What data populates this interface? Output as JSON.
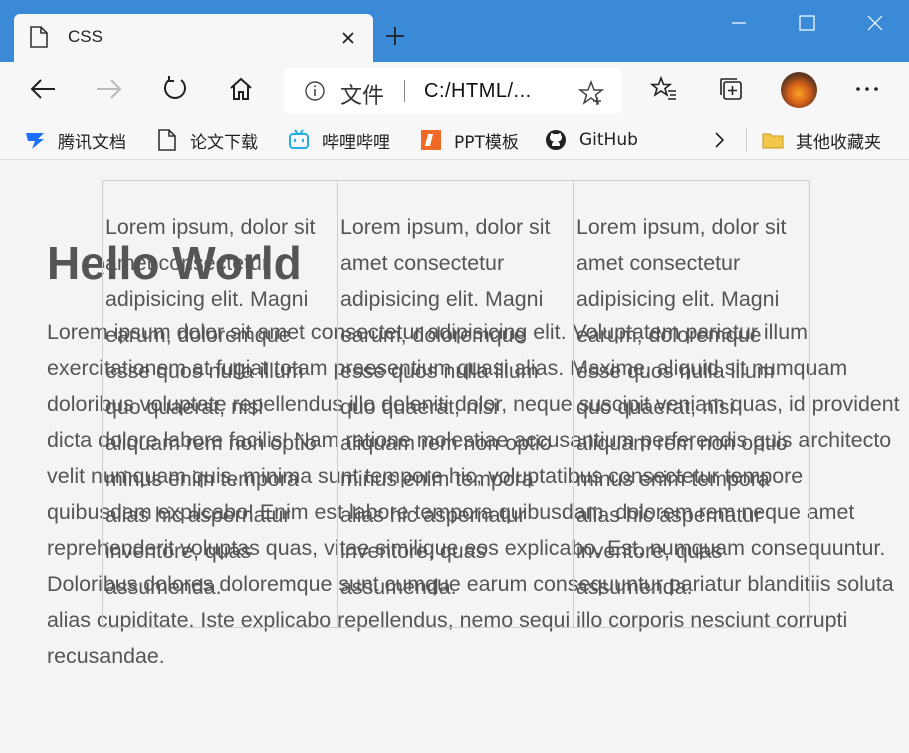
{
  "browser": {
    "tab": {
      "title": "CSS"
    },
    "address": {
      "scheme_label": "文件",
      "url": "C:/HTML/..."
    },
    "bookmarks": [
      {
        "label": "腾讯文档",
        "icon": "tencent-docs-icon"
      },
      {
        "label": "论文下载",
        "icon": "document-icon"
      },
      {
        "label": "哔哩哔哩",
        "icon": "bilibili-icon"
      },
      {
        "label": "PPT模板",
        "icon": "ppt-icon"
      },
      {
        "label": "GitHub",
        "icon": "github-icon"
      }
    ],
    "other_bookmarks": {
      "label": "其他收藏夹",
      "icon": "folder-icon"
    },
    "colors": {
      "titlebar": "#3b8ad8",
      "toolbar": "#f7f7f7",
      "page_bg": "#f4f4f4",
      "text": "#555555"
    }
  },
  "page": {
    "heading": "Hello World",
    "paragraph": "Lorem ipsum dolor sit amet consectetur adipisicing elit. Voluptatem pariatur illum exercitationem at fugiat totam praesentium quasi alias. Maxime, aliquid sit numquam doloribus voluptate repellendus illo deleniti dolor, neque suscipit veniam quas, id provident dicta dolore labore facilis! Nam ratione molestiae accusantium perferendis quis architecto velit numquam quis, minima sunt tempore hic, voluptatibus consectetur tempore quibusdam explicabo! Enim est labore tempora quibusdam, dolorem rem neque amet reprehenderit voluptas quas, vitae similique eos explicabo. Est, numquam consequuntur. Doloribus dolores doloremque sunt cumque earum consequuntur pariatur blanditiis soluta alias cupiditate. Iste explicabo repellendus, nemo sequi illo corporis nesciunt corrupti recusandae.",
    "columns": [
      {
        "text": "Lorem ipsum, dolor sit amet consectetur adipisicing elit. Magni earum, doloremque esse quos nulla illum quo quaerat, nisi aliquam rem non optio minus enim tempora alias hic aspernatur inventore, quas assumenda."
      },
      {
        "text": "Lorem ipsum, dolor sit amet consectetur adipisicing elit. Magni earum, doloremque esse quos nulla illum quo quaerat, nisi aliquam rem non optio minus enim tempora alias hic aspernatur inventore, quas assumenda."
      },
      {
        "text": "Lorem ipsum, dolor sit amet consectetur adipisicing elit. Magni earum, doloremque esse quos nulla illum quo quaerat, nisi aliquam rem non optio minus enim tempora alias hic aspernatur inventore, quas assumenda."
      }
    ]
  }
}
